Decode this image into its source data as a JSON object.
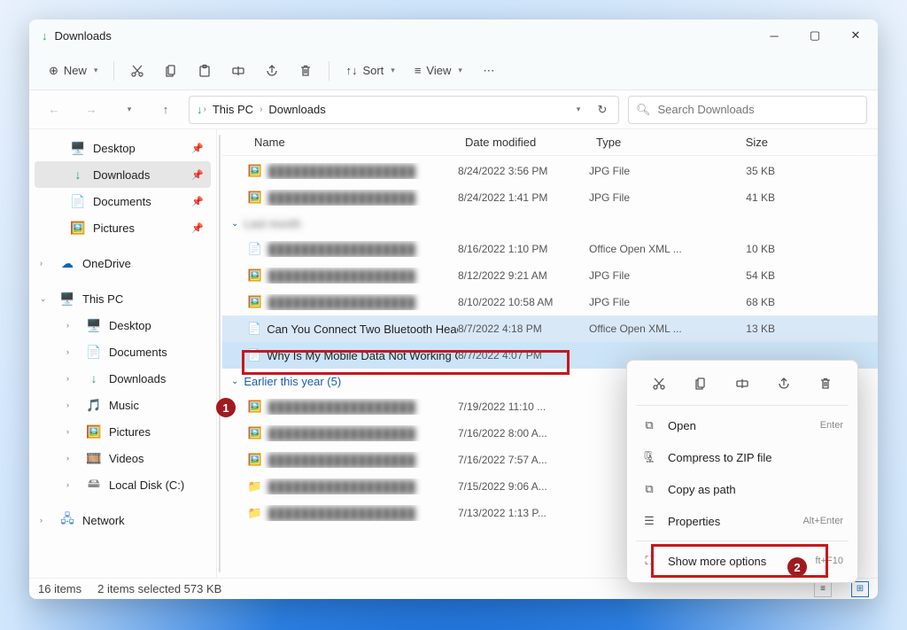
{
  "window": {
    "title": "Downloads"
  },
  "toolbar": {
    "new": "New",
    "sort": "Sort",
    "view": "View"
  },
  "breadcrumbs": [
    "This PC",
    "Downloads"
  ],
  "search": {
    "placeholder": "Search Downloads"
  },
  "sidebar": {
    "quick": [
      {
        "label": "Desktop",
        "icon": "desktop"
      },
      {
        "label": "Downloads",
        "icon": "download",
        "selected": true
      },
      {
        "label": "Documents",
        "icon": "document"
      },
      {
        "label": "Pictures",
        "icon": "pictures"
      }
    ],
    "onedrive": "OneDrive",
    "thispc": {
      "label": "This PC",
      "children": [
        {
          "label": "Desktop",
          "icon": "desktop"
        },
        {
          "label": "Documents",
          "icon": "document"
        },
        {
          "label": "Downloads",
          "icon": "download"
        },
        {
          "label": "Music",
          "icon": "music"
        },
        {
          "label": "Pictures",
          "icon": "pictures"
        },
        {
          "label": "Videos",
          "icon": "videos"
        },
        {
          "label": "Local Disk (C:)",
          "icon": "disk"
        }
      ]
    },
    "network": "Network"
  },
  "columns": {
    "name": "Name",
    "date": "Date modified",
    "type": "Type",
    "size": "Size"
  },
  "files": [
    {
      "name": "blurred",
      "date": "8/24/2022 3:56 PM",
      "type": "JPG File",
      "size": "35 KB",
      "blur": true,
      "icon": "img"
    },
    {
      "name": "blurred",
      "date": "8/24/2022 1:41 PM",
      "type": "JPG File",
      "size": "41 KB",
      "blur": true,
      "icon": "img"
    },
    {
      "group": "Last month",
      "count": "",
      "blurgrp": true
    },
    {
      "name": "blurred",
      "date": "8/16/2022 1:10 PM",
      "type": "Office Open XML ...",
      "size": "10 KB",
      "blur": true,
      "icon": "doc"
    },
    {
      "name": "blurred",
      "date": "8/12/2022 9:21 AM",
      "type": "JPG File",
      "size": "54 KB",
      "blur": true,
      "icon": "img"
    },
    {
      "name": "blurred",
      "date": "8/10/2022 10:58 AM",
      "type": "JPG File",
      "size": "68 KB",
      "blur": true,
      "icon": "img"
    },
    {
      "name": "Can You Connect Two Bluetooth Headph...",
      "date": "8/7/2022 4:18 PM",
      "type": "Office Open XML ...",
      "size": "13 KB",
      "icon": "doc",
      "hl": true
    },
    {
      "name": "Why Is My Mobile Data Not Working On ...",
      "date": "8/7/2022 4:07 PM",
      "type": "",
      "size": "",
      "icon": "doc",
      "boxed": true
    },
    {
      "group": "Earlier this year (5)"
    },
    {
      "name": "blurred",
      "date": "7/19/2022 11:10 ...",
      "type": "",
      "size": "",
      "blur": true,
      "icon": "img"
    },
    {
      "name": "blurred",
      "date": "7/16/2022 8:00 A...",
      "type": "",
      "size": "",
      "blur": true,
      "icon": "img"
    },
    {
      "name": "blurred",
      "date": "7/16/2022 7:57 A...",
      "type": "",
      "size": "",
      "blur": true,
      "icon": "img"
    },
    {
      "name": "blurred",
      "date": "7/15/2022 9:06 A...",
      "type": "",
      "size": "",
      "blur": true,
      "icon": "file"
    },
    {
      "name": "blurred",
      "date": "7/13/2022 1:13 P...",
      "type": "",
      "size": "",
      "blur": true,
      "icon": "file"
    }
  ],
  "context": {
    "open": "Open",
    "open_sc": "Enter",
    "zip": "Compress to ZIP file",
    "copypath": "Copy as path",
    "properties": "Properties",
    "prop_sc": "Alt+Enter",
    "more": "Show more options",
    "more_sc": "ft+F10"
  },
  "status": {
    "items": "16 items",
    "selected": "2 items selected  573 KB"
  },
  "badges": {
    "one": "1",
    "two": "2"
  }
}
